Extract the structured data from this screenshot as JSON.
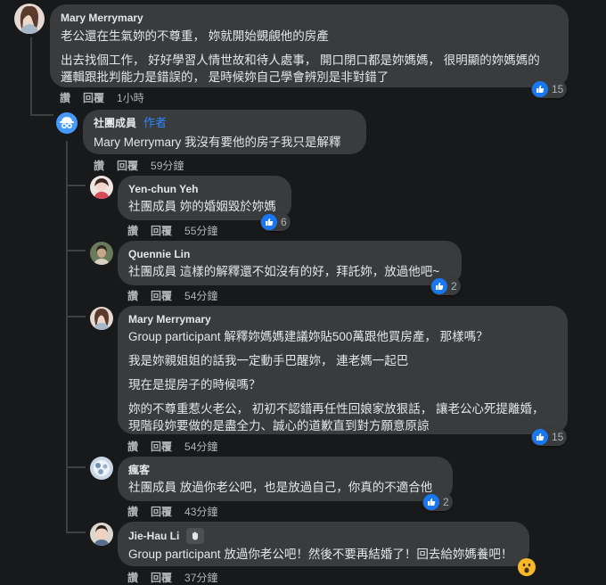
{
  "comments": [
    {
      "author": "Mary Merrymary",
      "paragraphs": [
        "老公還在生氣妳的不尊重， 妳就開始覬覦他的房產",
        "出去找個工作， 好好學習人情世故和待人處事， 開口閉口都是妳媽媽， 很明顯的妳媽媽的",
        "邏輯跟批判能力是錯誤的， 是時候妳自己學會辨別是非對錯了"
      ],
      "like_label": "讚",
      "reply_label": "回覆",
      "time": "1小時",
      "reactions": "15"
    },
    {
      "author": "社團成員",
      "author_tag": "作者",
      "mention": "Mary Merrymary",
      "text": "我沒有要他的房子我只是解釋",
      "like_label": "讚",
      "reply_label": "回覆",
      "time": "59分鐘"
    },
    {
      "author": "Yen-chun Yeh",
      "mention": "社團成員",
      "text": "妳的婚姻毀於妳媽",
      "like_label": "讚",
      "reply_label": "回覆",
      "time": "55分鐘",
      "reactions": "6"
    },
    {
      "author": "Quennie Lin",
      "mention": "社團成員",
      "text": "這樣的解釋還不如沒有的好，拜託妳，放過他吧~",
      "like_label": "讚",
      "reply_label": "回覆",
      "time": "54分鐘",
      "reactions": "2"
    },
    {
      "author": "Mary Merrymary",
      "mention": "Group participant",
      "paragraphs": [
        "解釋妳媽媽建議妳貼500萬跟他買房產， 那樣嗎？",
        "我是妳親姐姐的話我一定動手巴醒妳， 連老媽一起巴",
        "現在是提房子的時候嗎？",
        "妳的不尊重惹火老公， 初初不認錯再任性回娘家放狠話， 讓老公心死提離婚，",
        "現階段妳要做的是盡全力、誠心的道歉直到對方願意原諒"
      ],
      "like_label": "讚",
      "reply_label": "回覆",
      "time": "54分鐘",
      "reactions": "15"
    },
    {
      "author": "瘋客",
      "mention": "社團成員",
      "text": "放過你老公吧，也是放過自己，你真的不適合他",
      "like_label": "讚",
      "reply_label": "回覆",
      "time": "43分鐘",
      "reactions": "2"
    },
    {
      "author": "Jie-Hau Li",
      "mention": "Group participant",
      "text": "放過你老公吧！然後不要再結婚了！回去給妳媽養吧！",
      "like_label": "讚",
      "reply_label": "回覆",
      "time": "37分鐘"
    }
  ],
  "icons": {
    "like": "like-icon",
    "wow": "wow-icon",
    "wave": "wave-icon",
    "anonymous": "anonymous-member-icon"
  },
  "colors": {
    "background": "#18191a",
    "bubble": "#3a3b3c",
    "text": "#e4e6eb",
    "secondary": "#b0b3b8",
    "accent": "#2d88ff",
    "like": "#1877f2"
  }
}
